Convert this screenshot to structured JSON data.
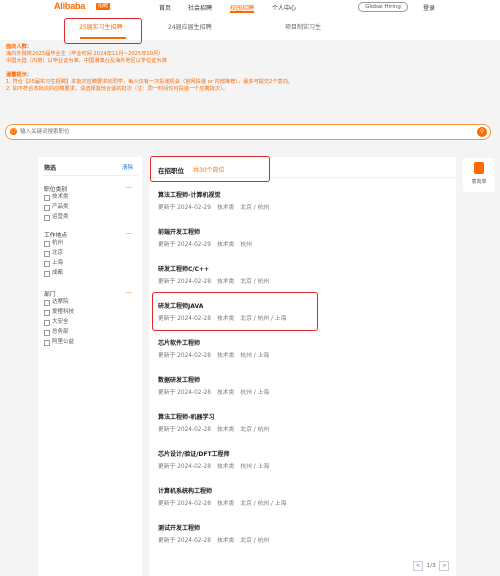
{
  "topnav": {
    "logo": "Alibaba",
    "logo_badge": "招聘",
    "items": [
      "首页",
      "社会招聘",
      "校园招聘",
      "个人中心"
    ],
    "global_hiring": "Global Hiring",
    "login": "登录"
  },
  "subtabs": [
    "25届实习生招聘",
    "24届应届生招聘",
    "项目制实习生"
  ],
  "notice": {
    "audience_title": "面向人群：",
    "audience_lines": [
      "海内外院校2025届毕业生（毕业时间 2024年11月~2025年10月）",
      "中国大陆（内地）以毕业证为准，中国港澳台及海外地区以学位证为准"
    ],
    "tips_title": "温馨提示：",
    "tips_lines": [
      "1. 符合【25届实习生招聘】本批次应聘要求的同学，每人仅有一次投递机会（官网投递 or 内部推荐），最多可提交2个意向。",
      "2. 如不符合本批次的应聘要求，请选择其他合适的批次（注：同一时间仅可投递一个应聘批次）。"
    ]
  },
  "search": {
    "placeholder": "输入关键词搜索职位"
  },
  "filter": {
    "title": "筛选",
    "clear": "清除",
    "groups": [
      {
        "title": "职位类别",
        "options": [
          "技术类",
          "产品类",
          "运营类"
        ]
      },
      {
        "title": "工作地点",
        "options": [
          "杭州",
          "北京",
          "上海",
          "成都"
        ]
      },
      {
        "title": "部门",
        "options": [
          "达摩院",
          "爱橙科技",
          "大安全",
          "总务部",
          "阿里公益"
        ]
      }
    ]
  },
  "list": {
    "title": "在招职位",
    "count": "共30个岗位",
    "jobs": [
      {
        "title": "算法工程师-计算机视觉",
        "updated": "更新于 2024-02-29",
        "category": "技术类",
        "location": "北京 / 杭州"
      },
      {
        "title": "前端开发工程师",
        "updated": "更新于 2024-02-29",
        "category": "技术类",
        "location": "杭州"
      },
      {
        "title": "研发工程师C/C++",
        "updated": "更新于 2024-02-28",
        "category": "技术类",
        "location": "北京 / 杭州"
      },
      {
        "title": "研发工程师JAVA",
        "updated": "更新于 2024-02-28",
        "category": "技术类",
        "location": "北京 / 杭州 / 上海"
      },
      {
        "title": "芯片软件工程师",
        "updated": "更新于 2024-02-28",
        "category": "技术类",
        "location": "杭州 / 上海"
      },
      {
        "title": "数据研发工程师",
        "updated": "更新于 2024-02-28",
        "category": "技术类",
        "location": "杭州 / 上海"
      },
      {
        "title": "算法工程师-机器学习",
        "updated": "更新于 2024-02-28",
        "category": "技术类",
        "location": "北京 / 杭州"
      },
      {
        "title": "芯片设计/验证/DFT工程师",
        "updated": "更新于 2024-02-28",
        "category": "技术类",
        "location": "杭州 / 上海"
      },
      {
        "title": "计算机系统构工程师",
        "updated": "更新于 2024-02-28",
        "category": "技术类",
        "location": "北京 / 杭州 / 上海"
      },
      {
        "title": "测试开发工程师",
        "updated": "更新于 2024-02-28",
        "category": "技术类",
        "location": "北京 / 杭州"
      }
    ],
    "pager": "1/3"
  },
  "side_widget": {
    "label": "意向单"
  },
  "colors": {
    "accent": "#ff6a00",
    "annotation": "#e0282e"
  }
}
